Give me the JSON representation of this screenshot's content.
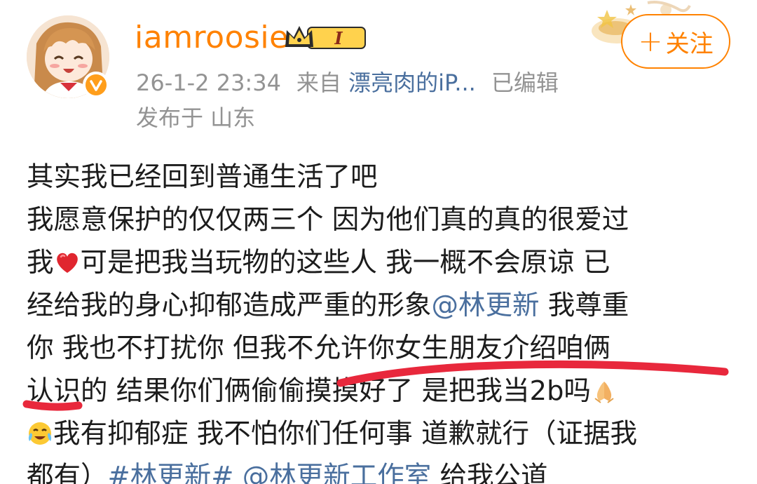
{
  "header": {
    "username": "iamroosie",
    "member_level": "I",
    "timestamp": "26-1-2 23:34",
    "source_prefix": "来自",
    "source_device": "漂亮肉的iP...",
    "edited_label": "已编辑",
    "location": "发布于 山东",
    "follow_label": "关注",
    "follow_icon": "+"
  },
  "post": {
    "lines": [
      [
        {
          "t": "其实我已经回到普通生活了吧"
        }
      ],
      [
        {
          "t": "我愿意保护的仅仅两三个 因为他们真的真的很爱过"
        }
      ],
      [
        {
          "t": "我"
        },
        {
          "emoji": "red-heart"
        },
        {
          "t": "可是把我当玩物的这些人 我一概不会原谅 已"
        }
      ],
      [
        {
          "t": "经给我的身心抑郁造成严重的形象"
        },
        {
          "link": "@林更新"
        },
        {
          "t": " 我尊重"
        }
      ],
      [
        {
          "t": "你 我也不打扰你 但我不允许你女生朋友介绍咱俩"
        }
      ],
      [
        {
          "t": "认识的 结果你们俩偷偷摸摸好了 是把我当2b吗"
        },
        {
          "emoji": "folded-hands"
        }
      ],
      [
        {
          "emoji": "crying-face"
        },
        {
          "t": "我有抑郁症 我不怕你们任何事 道歉就行（证据我"
        }
      ],
      [
        {
          "t": "都有）"
        },
        {
          "link": "#林更新#"
        },
        {
          "t": " "
        },
        {
          "link": "@林更新工作室"
        },
        {
          "t": " 给我公道"
        }
      ]
    ]
  },
  "colors": {
    "username": "#ff8200",
    "link": "#4a6f9e",
    "meta": "#939393",
    "follow_border": "#ff8200",
    "verified": "#ff9e1b",
    "annotation": "#e8283c"
  }
}
